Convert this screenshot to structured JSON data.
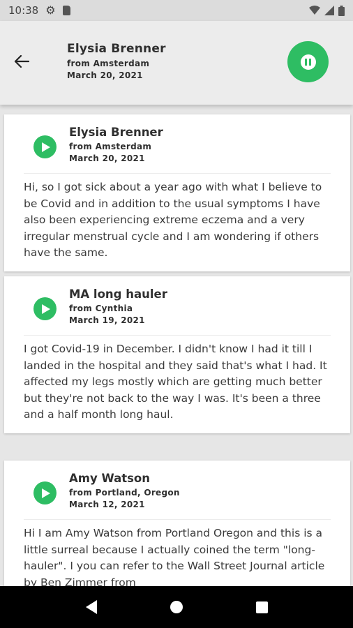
{
  "status": {
    "time": "10:38"
  },
  "header": {
    "name": "Elysia Brenner",
    "from": "from Amsterdam",
    "date": "March 20, 2021"
  },
  "stories": [
    {
      "name": "Elysia Brenner",
      "from": "from Amsterdam",
      "date": "March 20, 2021",
      "text": "Hi, so I got sick about a year ago with what I believe to be Covid and in addition to the usual symptoms I have also been experiencing extreme eczema and a very irregular menstrual cycle and I am wondering if others have the same."
    },
    {
      "name": "MA long hauler",
      "from": "from Cynthia",
      "date": "March 19, 2021",
      "text": "I got Covid-19 in December. I didn't know I had it till I landed in the hospital and they said that's what I had. It affected my legs mostly which are getting much better but they're not back to the way I was.  It's been a three and a half month long haul."
    },
    {
      "name": "Amy Watson",
      "from": "from Portland, Oregon",
      "date": "March 12, 2021",
      "text": "Hi I am Amy Watson from Portland Oregon and this is a little surreal because I actually coined the term \"long-hauler\".  I you can refer to the Wall Street Journal article by Ben Zimmer from"
    }
  ],
  "colors": {
    "accent": "#2ebd63"
  }
}
